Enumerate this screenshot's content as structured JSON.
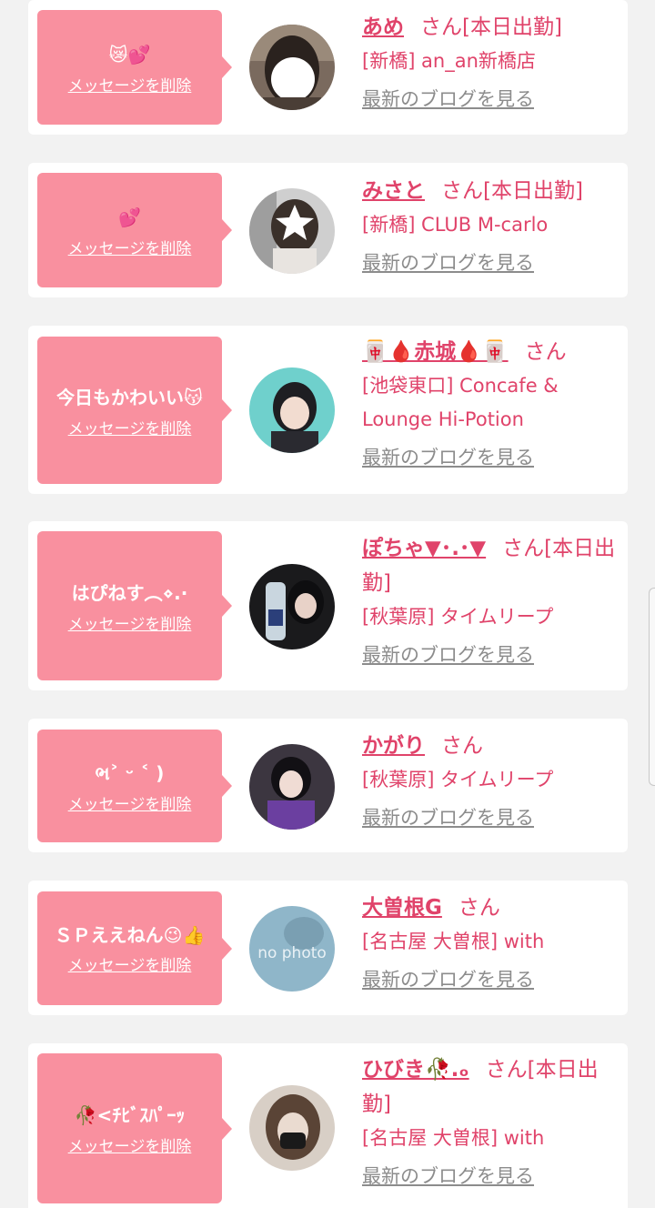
{
  "cards": [
    {
      "message": "😿💕",
      "delete_label": "メッセージを削除",
      "name": "あめ",
      "suffix": "さん[本日出勤]",
      "shop": "[新橋] an_an新橋店",
      "blog_label": "最新のブログを見る",
      "avatar_icon": "avatar-photo"
    },
    {
      "message": "💕",
      "delete_label": "メッセージを削除",
      "name": "みさと",
      "suffix": "さん[本日出勤]",
      "shop": "[新橋] CLUB M-carlo",
      "blog_label": "最新のブログを見る",
      "avatar_icon": "avatar-photo"
    },
    {
      "message": "今日もかわいい😽",
      "delete_label": "メッセージを削除",
      "name": "🀄🩸赤城🩸🀄",
      "suffix": "さん",
      "shop": "[池袋東口] Concafe & Lounge Hi-Potion",
      "blog_label": "最新のブログを見る",
      "avatar_icon": "avatar-photo"
    },
    {
      "message": "はぴねす︵⋄.·",
      "delete_label": "メッセージを削除",
      "name": "ぽちゃ▼･.･▼",
      "suffix": "さん[本日出勤]",
      "shop": "[秋葉原] タイムリープ",
      "blog_label": "最新のブログを見る",
      "avatar_icon": "avatar-photo"
    },
    {
      "message": "ભ˃ ᵕ ˂ )",
      "delete_label": "メッセージを削除",
      "name": "かがり",
      "suffix": "さん",
      "shop": "[秋葉原] タイムリープ",
      "blog_label": "最新のブログを見る",
      "avatar_icon": "avatar-photo"
    },
    {
      "message": "ＳＰええねん😉👍",
      "delete_label": "メッセージを削除",
      "name": "大曽根G",
      "suffix": "さん",
      "shop": "[名古屋 大曽根] with",
      "blog_label": "最新のブログを見る",
      "avatar_icon": "no-photo-placeholder",
      "avatar_text": "no photo"
    },
    {
      "message": "🥀<ﾁﾋﾞｽﾊﾟｰｯ",
      "delete_label": "メッセージを削除",
      "name": "ひびき🥀.ₒ",
      "suffix": "さん[本日出勤]",
      "shop": "[名古屋 大曽根] with",
      "blog_label": "最新のブログを見る",
      "avatar_icon": "avatar-photo"
    }
  ],
  "colors": {
    "bubble": "#f9909f",
    "accent": "#e0436a",
    "muted": "#8c8c8c",
    "background": "#f2f2f2"
  }
}
